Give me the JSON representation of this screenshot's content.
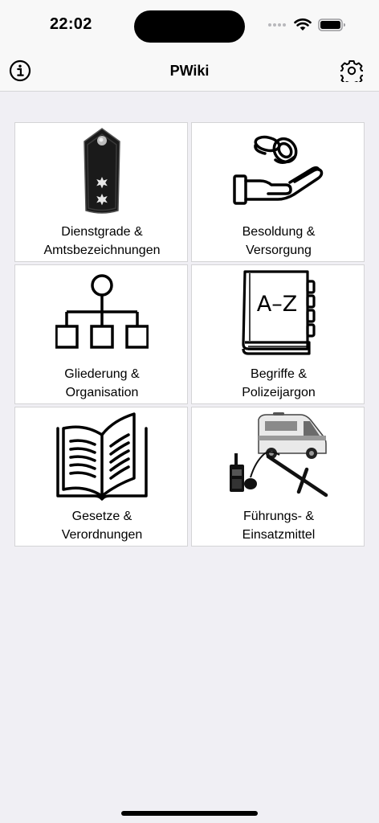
{
  "status_bar": {
    "time": "22:02",
    "icons": [
      "cellular-signal-icon",
      "wifi-icon",
      "battery-icon"
    ]
  },
  "nav": {
    "title": "PWiki",
    "left_icon": "info-icon",
    "right_icon": "gear-icon"
  },
  "tiles": [
    {
      "line1": "Dienstgrade &",
      "line2": "Amtsbezeichnungen",
      "icon": "shoulder-board-icon"
    },
    {
      "line1": "Besoldung &",
      "line2": "Versorgung",
      "icon": "coins-hand-icon"
    },
    {
      "line1": "Gliederung &",
      "line2": "Organisation",
      "icon": "org-chart-icon"
    },
    {
      "line1": "Begriffe &",
      "line2": "Polizeijargon",
      "icon": "a-z-book-icon"
    },
    {
      "line1": "Gesetze &",
      "line2": "Verordnungen",
      "icon": "open-book-icon"
    },
    {
      "line1": "Führungs- &",
      "line2": "Einsatzmittel",
      "icon": "police-equipment-icon"
    }
  ],
  "icon_text": {
    "az": "A–Z"
  },
  "colors": {
    "background": "#f0eff4",
    "tile": "#ffffff",
    "tile_border": "#d4d4d6",
    "icon": "#000000"
  }
}
